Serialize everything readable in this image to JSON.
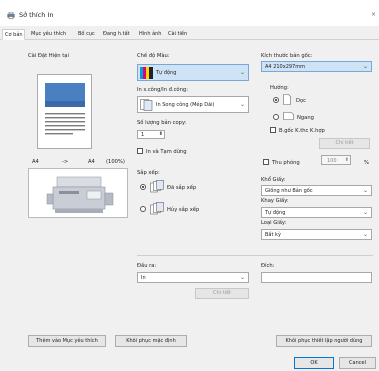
{
  "window": {
    "title": "Sở thích In"
  },
  "tabs": [
    "Cơ bản",
    "Mục yêu thích",
    "Bố cục",
    "Đang h.tất",
    "Hình ảnh",
    "Cài tiến"
  ],
  "left": {
    "current_settings_label": "Cài Đặt Hiện tại",
    "paper_from": "A4",
    "arrow": "->",
    "paper_to": "A4",
    "zoom": "(100%)"
  },
  "mid": {
    "color_mode_label": "Chế độ Màu:",
    "color_mode_value": "Tự động",
    "duplex_label": "In s.công/In đ.công:",
    "duplex_value": "In Song công (Mép Dài)",
    "copies_label": "Số lượng bản copy:",
    "copies_value": "1",
    "print_pause_label": "In và Tạm dừng",
    "sort_label": "Sắp xếp:",
    "collate_label": "Đã sắp xếp",
    "uncollate_label": "Hủy sắp xếp"
  },
  "right": {
    "original_size_label": "Kích thước bản gốc:",
    "original_size_value": "A4 210x297mm",
    "orientation_label": "Hướng:",
    "portrait_label": "Dọc",
    "landscape_label": "Ngang",
    "mixed_label": "B.gốc K.thc K.hợp",
    "detail_label": "Chi tiết",
    "zoom_label": "Thu phóng",
    "zoom_value": "100",
    "zoom_unit": "%",
    "paper_size_label": "Khổ Giấy:",
    "paper_size_value": "Giống như Bản gốc",
    "tray_label": "Khay Giấy:",
    "tray_value": "Tự động",
    "paper_type_label": "Loại Giấy:",
    "paper_type_value": "Bất kỳ"
  },
  "output": {
    "output_label": "Đầu ra:",
    "output_value": "In",
    "detail_label": "Chi tiết",
    "dest_label": "Đích:"
  },
  "footer": {
    "add_fav": "Thêm vào Mục yêu thích",
    "restore_default": "Khôi phục mặc định",
    "restore_user": "Khôi phục thiết lập người dùng",
    "ok": "OK",
    "cancel": "Cancel"
  }
}
